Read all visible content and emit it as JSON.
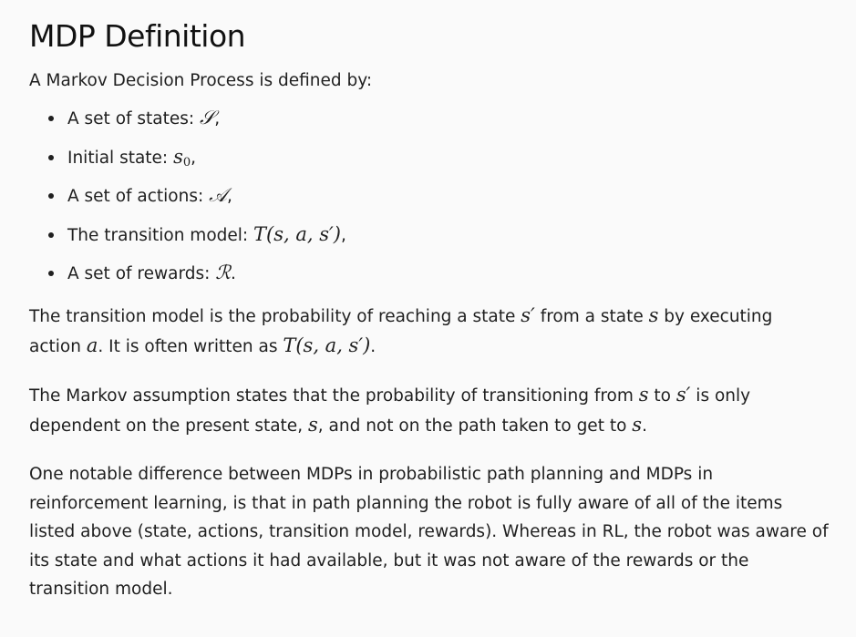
{
  "title": "MDP Definition",
  "intro": "A Markov Decision Process is defined by:",
  "list": [
    {
      "text": "A set of states: ",
      "math": "𝒮",
      "after": ","
    },
    {
      "text": "Initial state: ",
      "math": "s",
      "sub": "0",
      "after": ","
    },
    {
      "text": "A set of actions: ",
      "math": "𝒜",
      "after": ","
    },
    {
      "text": "The transition model: ",
      "math": "T(s, a, s′)",
      "after": ","
    },
    {
      "text": "A set of rewards: ",
      "math": "ℛ",
      "after": "."
    }
  ],
  "p1": {
    "a": "The transition model is the probability of reaching a state ",
    "m1": "s′",
    "b": " from a state ",
    "m2": "s",
    "c": " by executing action ",
    "m3": "a",
    "d": ". It is often written as ",
    "m4": "T(s, a, s′)",
    "e": "."
  },
  "p2": {
    "a": "The Markov assumption states that the probability of transitioning from ",
    "m1": "s",
    "b": " to ",
    "m2": "s′",
    "c": " is only dependent on the present state, ",
    "m3": "s",
    "d": ", and not on the path taken to get to ",
    "m4": "s",
    "e": "."
  },
  "p3": "One notable difference between MDPs in probabilistic path planning and MDPs in reinforcement learning, is that in path planning the robot is fully aware of all of the items listed above (state, actions, transition model, rewards). Whereas in RL, the robot was aware of its state and what actions it had available, but it was not aware of the rewards or the transition model."
}
